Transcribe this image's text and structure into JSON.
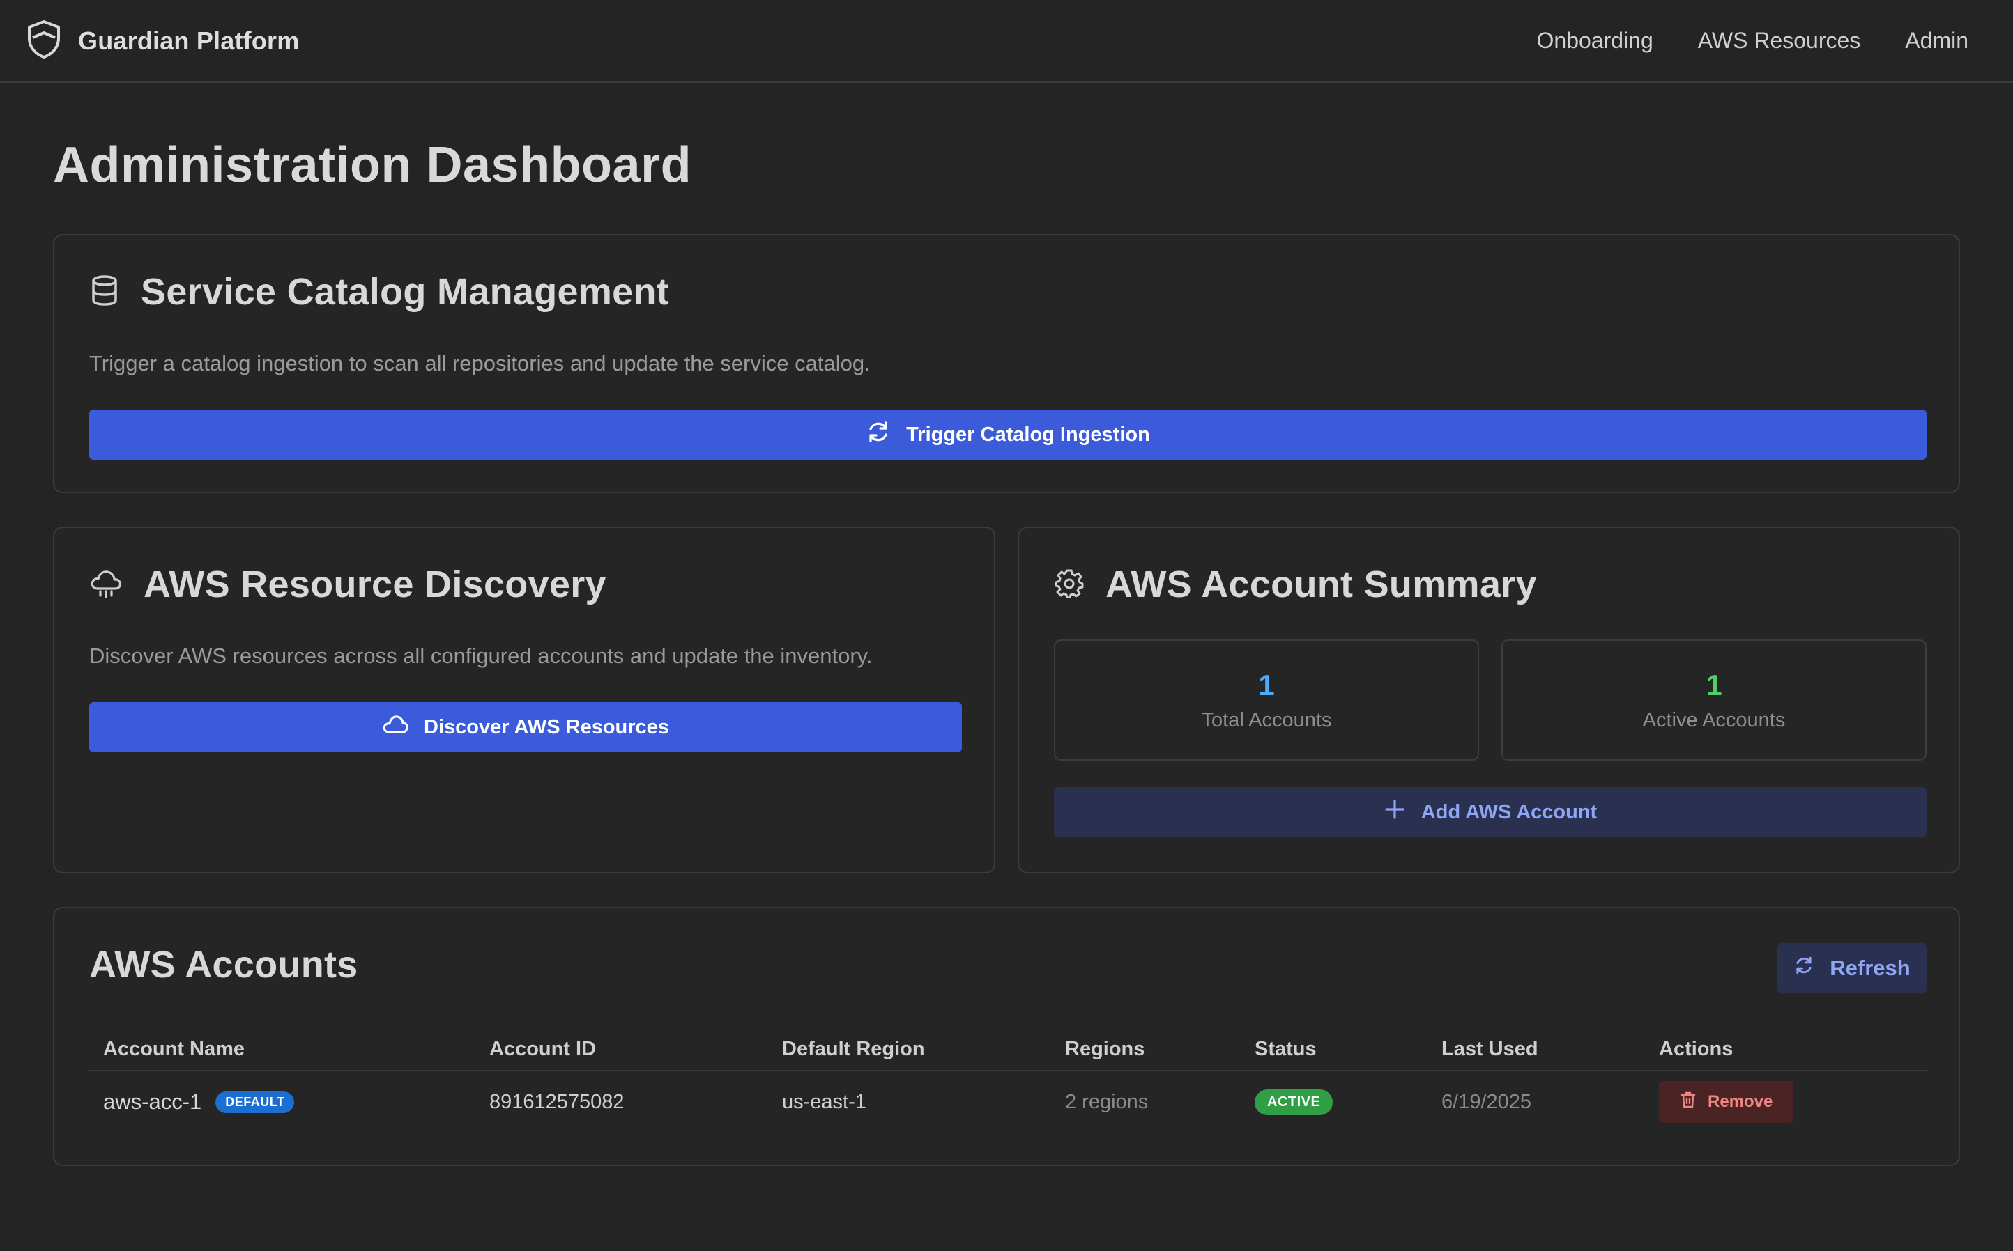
{
  "app": {
    "brand": "Guardian Platform",
    "nav": [
      "Onboarding",
      "AWS Resources",
      "Admin"
    ]
  },
  "page": {
    "title": "Administration Dashboard"
  },
  "catalog": {
    "title": "Service Catalog Management",
    "description": "Trigger a catalog ingestion to scan all repositories and update the service catalog.",
    "button": "Trigger Catalog Ingestion"
  },
  "discovery": {
    "title": "AWS Resource Discovery",
    "description": "Discover AWS resources across all configured accounts and update the inventory.",
    "button": "Discover AWS Resources"
  },
  "summary": {
    "title": "AWS Account Summary",
    "total_value": "1",
    "total_label": "Total Accounts",
    "active_value": "1",
    "active_label": "Active Accounts",
    "add_button": "Add AWS Account"
  },
  "accounts": {
    "title": "AWS Accounts",
    "refresh": "Refresh",
    "columns": [
      "Account Name",
      "Account ID",
      "Default Region",
      "Regions",
      "Status",
      "Last Used",
      "Actions"
    ],
    "rows": [
      {
        "name": "aws-acc-1",
        "badge": "DEFAULT",
        "account_id": "891612575082",
        "default_region": "us-east-1",
        "regions": "2 regions",
        "status": "ACTIVE",
        "last_used": "6/19/2025",
        "action": "Remove"
      }
    ]
  },
  "colors": {
    "accent": "#3b5bdb",
    "total_value": "#4dabf7",
    "active_value": "#51cf66",
    "status_active": "#2f9e44",
    "danger": "#f08585"
  },
  "icons": {
    "brand": "shield-icon",
    "catalog": "database-icon",
    "catalog_button": "refresh-icon",
    "discovery": "cloud-icon",
    "discovery_button": "cloud-icon",
    "summary": "gear-icon",
    "add_button": "plus-icon",
    "refresh_button": "refresh-icon",
    "remove_button": "trash-icon"
  }
}
